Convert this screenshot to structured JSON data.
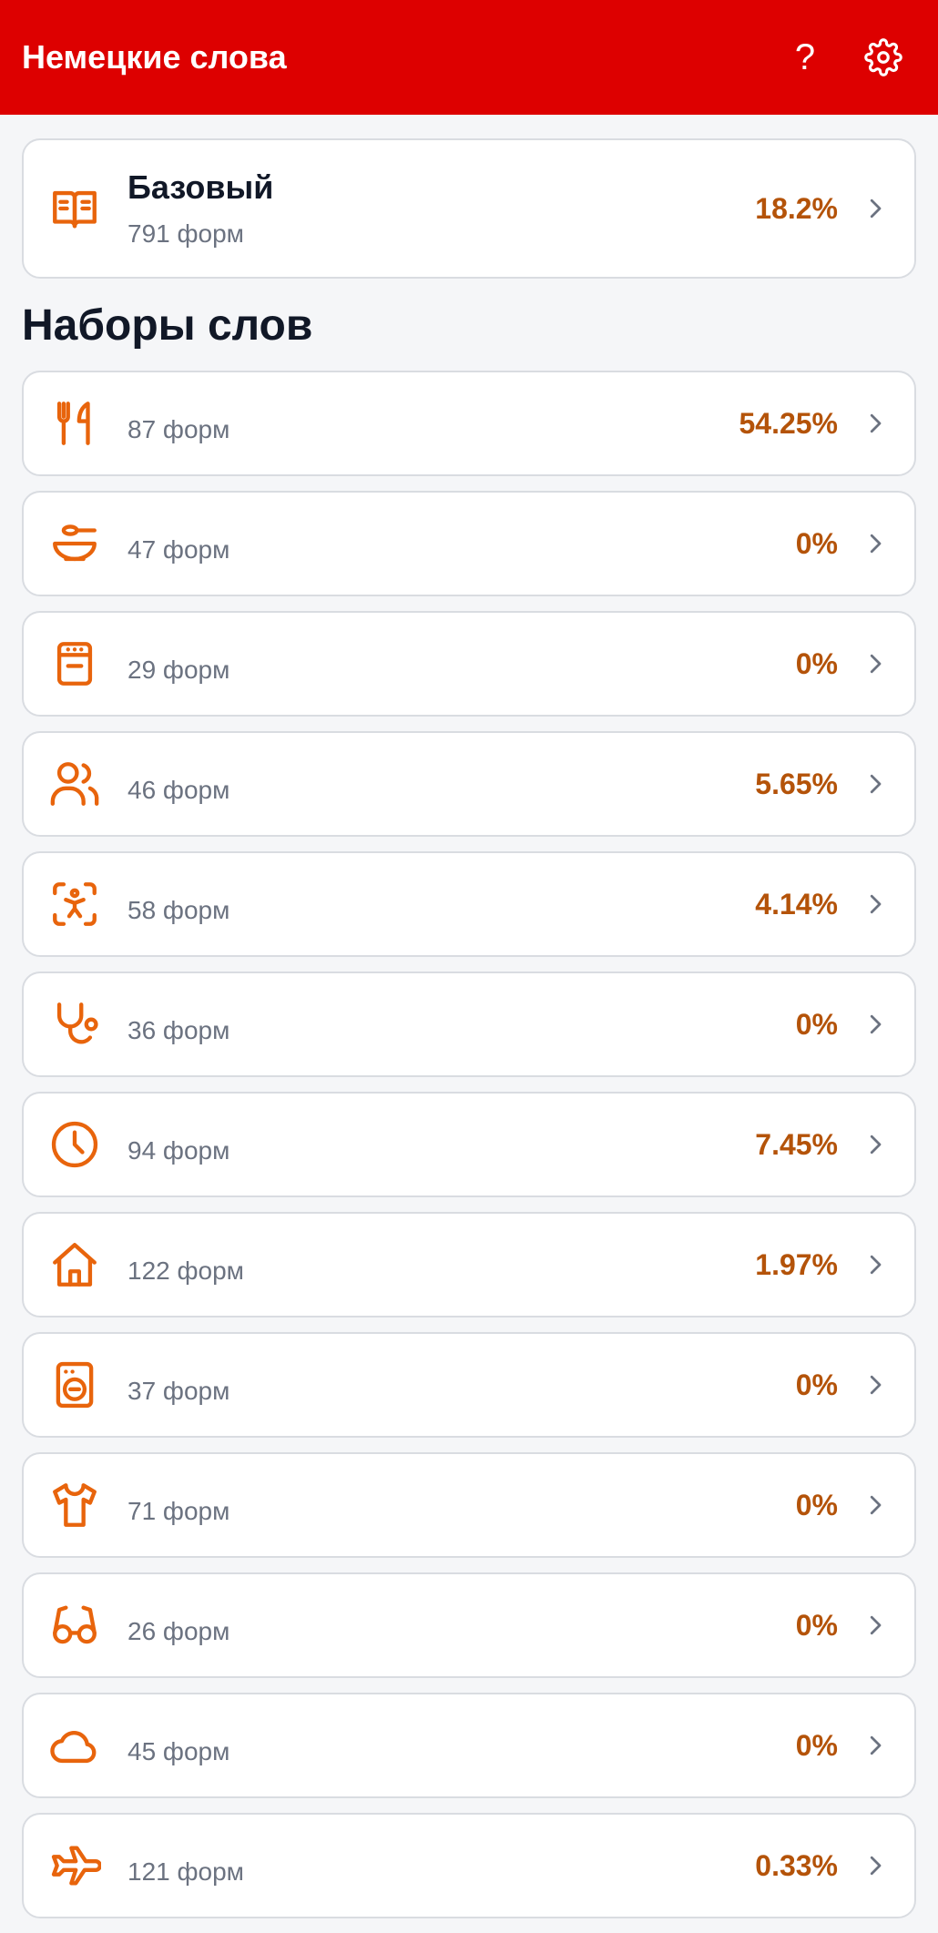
{
  "appbar": {
    "title": "Немецкие слова",
    "help_label": "?"
  },
  "base": {
    "title": "Базовый",
    "count": "791 форм",
    "percent": "18.2%",
    "icon": "book-icon"
  },
  "section_title": "Наборы слов",
  "sets": [
    {
      "icon": "utensils-icon",
      "count": "87 форм",
      "percent": "54.25%"
    },
    {
      "icon": "bowl-icon",
      "count": "47 форм",
      "percent": "0%"
    },
    {
      "icon": "stove-icon",
      "count": "29 форм",
      "percent": "0%"
    },
    {
      "icon": "users-icon",
      "count": "46 форм",
      "percent": "5.65%"
    },
    {
      "icon": "body-scan-icon",
      "count": "58 форм",
      "percent": "4.14%"
    },
    {
      "icon": "stethoscope-icon",
      "count": "36 форм",
      "percent": "0%"
    },
    {
      "icon": "clock-icon",
      "count": "94 форм",
      "percent": "7.45%"
    },
    {
      "icon": "house-icon",
      "count": "122 форм",
      "percent": "1.97%"
    },
    {
      "icon": "washing-machine-icon",
      "count": "37 форм",
      "percent": "0%"
    },
    {
      "icon": "shirt-icon",
      "count": "71 форм",
      "percent": "0%"
    },
    {
      "icon": "glasses-icon",
      "count": "26 форм",
      "percent": "0%"
    },
    {
      "icon": "cloud-icon",
      "count": "45 форм",
      "percent": "0%"
    },
    {
      "icon": "plane-icon",
      "count": "121 форм",
      "percent": "0.33%"
    }
  ],
  "colors": {
    "appbar": "#dd0000",
    "accent_icon": "#e8640c",
    "percent": "#b45309"
  }
}
